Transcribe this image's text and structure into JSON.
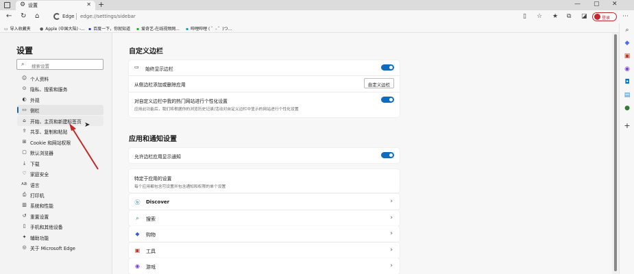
{
  "window": {
    "tab_title": "设置",
    "tab_icon": "gear-icon",
    "new_tab": "+",
    "minimize": "—",
    "maximize": "▢",
    "close": "✕"
  },
  "address_bar": {
    "site_name": "Edge",
    "url_path": "edge://settings/sidebar",
    "login_label": "登录"
  },
  "bookmarks": [
    {
      "label": "导入收藏夹",
      "icon": "folder-icon"
    },
    {
      "label": "Apple (中国大陆) -...",
      "icon": "apple-icon"
    },
    {
      "label": "百度一下，你就知道",
      "icon": "baidu-icon"
    },
    {
      "label": "爱奇艺-在线视频网...",
      "icon": "iqiyi-icon"
    },
    {
      "label": "哔哩哔哩 ( ゜- ゜)つ...",
      "icon": "bilibili-icon"
    }
  ],
  "settings_nav": {
    "title": "设置",
    "search_placeholder": "搜索设置",
    "items": [
      {
        "label": "个人资料",
        "icon": "person-icon"
      },
      {
        "label": "隐私、搜索和服务",
        "icon": "lock-icon"
      },
      {
        "label": "外观",
        "icon": "appearance-icon"
      },
      {
        "label": "侧栏",
        "icon": "sidebar-icon"
      },
      {
        "label": "开始、主页和新建标签页",
        "icon": "home-icon"
      },
      {
        "label": "共享、复制和粘贴",
        "icon": "share-icon"
      },
      {
        "label": "Cookie 和网站权限",
        "icon": "cookie-icon"
      },
      {
        "label": "默认浏览器",
        "icon": "browser-icon"
      },
      {
        "label": "下载",
        "icon": "download-icon"
      },
      {
        "label": "家庭安全",
        "icon": "family-icon"
      },
      {
        "label": "语言",
        "icon": "language-icon"
      },
      {
        "label": "打印机",
        "icon": "printer-icon"
      },
      {
        "label": "系统和性能",
        "icon": "system-icon"
      },
      {
        "label": "重置设置",
        "icon": "reset-icon"
      },
      {
        "label": "手机和其他设备",
        "icon": "phone-icon"
      },
      {
        "label": "辅助功能",
        "icon": "accessibility-icon"
      },
      {
        "label": "关于 Microsoft Edge",
        "icon": "edge-icon"
      }
    ],
    "active_index": 3
  },
  "customize_section": {
    "title": "自定义边栏",
    "always_show_label": "始终显示边栏",
    "always_show_on": true,
    "add_remove_label": "从侧边栏添加或删除应用",
    "customize_button": "自定义边栏",
    "personalize_label": "对自定义边栏中我的热门网站进行个性化设置",
    "personalize_desc": "应用此功能后，我们将根据你的浏览历史记录/活动对自定义边栏中显示的网站进行个性化设置",
    "personalize_on": true
  },
  "app_section": {
    "title": "应用和通知设置",
    "allow_notify_label": "允许边栏应用显示通知",
    "allow_notify_on": true,
    "specific_title": "特定于应用的设置",
    "specific_desc": "每个应用都包含可设置并包含通知和权限的单个设置",
    "apps": [
      {
        "label": "Discover",
        "icon": "discover-icon"
      },
      {
        "label": "搜索",
        "icon": "search-icon"
      },
      {
        "label": "购物",
        "icon": "shopping-icon"
      },
      {
        "label": "工具",
        "icon": "tools-icon"
      },
      {
        "label": "游戏",
        "icon": "games-icon"
      }
    ]
  },
  "colors": {
    "accent": "#0f6cbd",
    "login_red": "#c4262e",
    "arrow_red": "#c62828"
  }
}
